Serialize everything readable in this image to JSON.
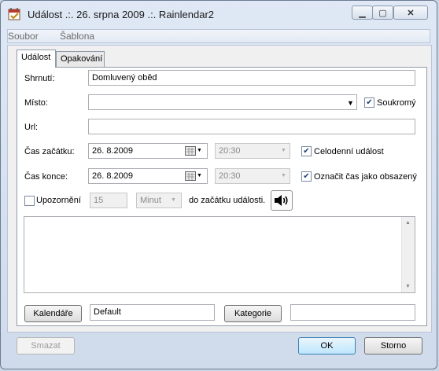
{
  "window": {
    "title": "Událost .:. 26. srpna 2009 .:. Rainlendar2"
  },
  "menu": {
    "items": [
      "Soubor",
      "Šablona"
    ]
  },
  "tabs": [
    {
      "label": "Událost",
      "active": true
    },
    {
      "label": "Opakování",
      "active": false
    }
  ],
  "form": {
    "summary_label": "Shrnutí:",
    "summary_value": "Domluvený oběd",
    "location_label": "Místo:",
    "location_value": "",
    "private_label": "Soukromý",
    "private_checked": true,
    "url_label": "Url:",
    "url_value": "",
    "start_label": "Čas začátku:",
    "start_date": "26.  8.2009",
    "start_time": "20:30",
    "allday_label": "Celodenní událost",
    "allday_checked": true,
    "end_label": "Čas konce:",
    "end_date": "26.  8.2009",
    "end_time": "20:30",
    "busy_label": "Označit čas jako obsazený",
    "busy_checked": true,
    "reminder_label": "Upozornění",
    "reminder_checked": false,
    "reminder_value": "15",
    "reminder_unit": "Minut",
    "reminder_suffix": "do začátku události.",
    "calendars_button": "Kalendáře",
    "calendar_value": "Default",
    "category_button": "Kategorie",
    "category_value": ""
  },
  "footer": {
    "delete": "Smazat",
    "ok": "OK",
    "cancel": "Storno"
  }
}
